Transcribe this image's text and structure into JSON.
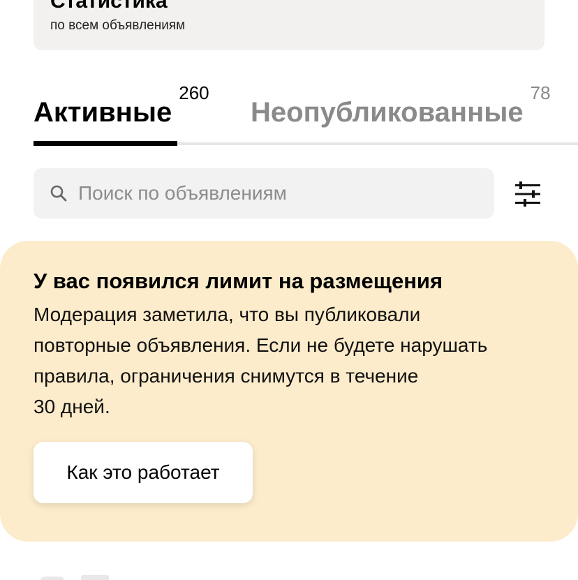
{
  "stats": {
    "title": "Статистика",
    "subtitle": "по всем объявлениям"
  },
  "tabs": [
    {
      "label": "Активные",
      "count": "260",
      "active": true
    },
    {
      "label": "Неопубликованные",
      "count": "78",
      "active": false
    }
  ],
  "search": {
    "placeholder": "Поиск по объявлениям",
    "icon": "search-icon"
  },
  "filter": {
    "icon": "sliders-icon"
  },
  "notice": {
    "title": "У вас появился лимит на размещения",
    "lines": [
      "Модерация заметила, что вы публиковали",
      "повторные объявления. Если не будете нарушать",
      "правила, ограничения снимутся в течение",
      "30 дней."
    ],
    "button_label": "Как это работает",
    "background": "#fdeccb"
  },
  "colors": {
    "accent": "#000000",
    "muted": "#8a8a8a",
    "card_bg": "#f2f1ef"
  }
}
